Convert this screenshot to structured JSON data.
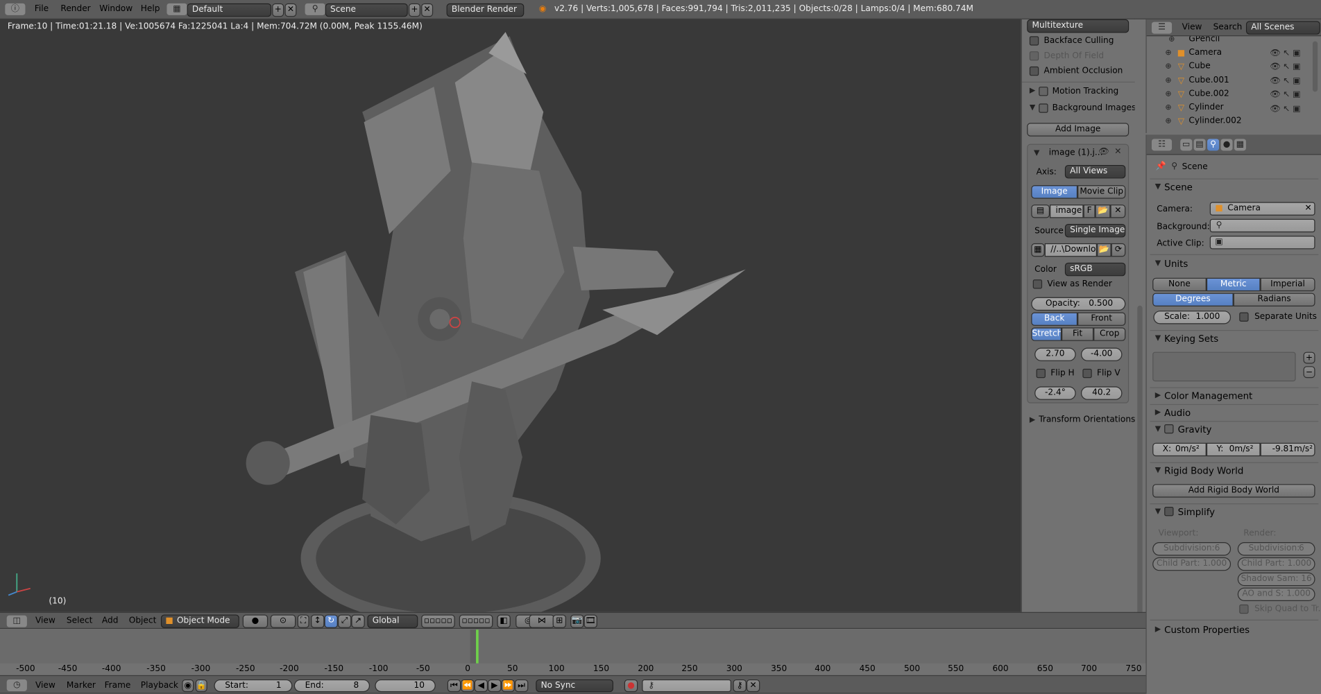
{
  "top": {
    "menus": [
      "File",
      "Render",
      "Window",
      "Help"
    ],
    "layout": "Default",
    "scene": "Scene",
    "engine": "Blender Render",
    "stats": "v2.76 | Verts:1,005,678 | Faces:991,794 | Tris:2,011,235 | Objects:0/28 | Lamps:0/4 | Mem:680.74M"
  },
  "viewport": {
    "info": "Frame:10 | Time:01:21.18 | Ve:1005674 Fa:1225041 La:4 | Mem:704.72M (0.00M, Peak 1155.46M)",
    "frame_label": "(10)"
  },
  "vp_header": {
    "menus": [
      "View",
      "Select",
      "Add",
      "Object"
    ],
    "mode": "Object Mode",
    "orientation": "Global"
  },
  "npanel": {
    "shading": "Multitexture",
    "backface": "Backface Culling",
    "dof": "Depth Of Field",
    "ao": "Ambient Occlusion",
    "motion": "Motion Tracking",
    "bgimages": "Background Images",
    "add_image": "Add Image",
    "image_name": "image (1).j...",
    "axis_label": "Axis:",
    "axis_value": "All Views",
    "tab_image": "Image",
    "tab_clip": "Movie Clip",
    "img_field": "image",
    "img_f": "F",
    "source_label": "Source",
    "source_value": "Single Image",
    "path": "//..\\Downlo...",
    "color_label": "Color",
    "color_value": "sRGB",
    "view_render": "View as Render",
    "opacity_label": "Opacity:",
    "opacity_value": "0.500",
    "back": "Back",
    "front": "Front",
    "stretch": "Stretch",
    "fit": "Fit",
    "crop": "Crop",
    "x": "2.70",
    "y": "-4.00",
    "fliph": "Flip H",
    "flipv": "Flip V",
    "rot": "-2.4°",
    "size": "40.2",
    "transform": "Transform Orientations"
  },
  "outliner": {
    "menus": [
      "View",
      "Search"
    ],
    "filter": "All Scenes",
    "items": [
      "GPencil",
      "Camera",
      "Cube",
      "Cube.001",
      "Cube.002",
      "Cylinder",
      "Cylinder.002"
    ]
  },
  "props": {
    "context": "Scene",
    "scene_header": "Scene",
    "camera_label": "Camera:",
    "camera_value": "Camera",
    "background_label": "Background:",
    "active_clip_label": "Active Clip:",
    "units": "Units",
    "none": "None",
    "metric": "Metric",
    "imperial": "Imperial",
    "degrees": "Degrees",
    "radians": "Radians",
    "scale": "Scale:",
    "scale_value": "1.000",
    "separate": "Separate Units",
    "keying": "Keying Sets",
    "color_mgmt": "Color Management",
    "audio": "Audio",
    "gravity": "Gravity",
    "gx": "X:",
    "gx_v": "0m/s²",
    "gy": "Y:",
    "gy_v": "0m/s²",
    "gz_v": "-9.81m/s²",
    "rigid": "Rigid Body World",
    "add_rigid": "Add Rigid Body World",
    "simplify": "Simplify",
    "viewport": "Viewport:",
    "render": "Render:",
    "subdiv": "Subdivision:",
    "subdiv_v": "6",
    "child": "Child Part: 1.000",
    "shadow": "Shadow Sam: 16",
    "aos": "AO and S:  1.000",
    "skipquad": "Skip Quad to Tr...",
    "custom": "Custom Properties"
  },
  "timeline": {
    "ticks": [
      "-500",
      "-450",
      "-400",
      "-350",
      "-300",
      "-250",
      "-200",
      "-150",
      "-100",
      "-50",
      "0",
      "50",
      "100",
      "150",
      "200",
      "250",
      "300",
      "350",
      "400",
      "450",
      "500",
      "550",
      "600",
      "650",
      "700",
      "750"
    ],
    "menus": [
      "View",
      "Marker",
      "Frame",
      "Playback"
    ],
    "start": "Start:",
    "start_v": "1",
    "end": "End:",
    "end_v": "8",
    "current": "10",
    "sync": "No Sync"
  }
}
